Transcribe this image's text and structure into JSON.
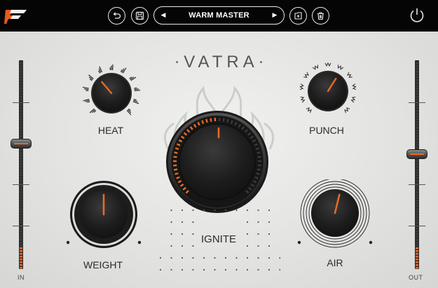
{
  "toolbar": {
    "preset_name": "WARM MASTER",
    "prev_arrow": "◀",
    "next_arrow": "▶",
    "undo_icon": "undo-icon",
    "save_icon": "save-icon",
    "new_preset_icon": "new-preset-icon",
    "delete_icon": "trash-icon",
    "power_icon": "power-icon",
    "logo_icon": "brand-logo"
  },
  "plugin": {
    "title": "VATRA"
  },
  "knobs": {
    "heat": {
      "label": "HEAT",
      "value": 0.35
    },
    "punch": {
      "label": "PUNCH",
      "value": 0.62
    },
    "ignite": {
      "label": "IGNITE",
      "value": 0.5
    },
    "weight": {
      "label": "WEIGHT",
      "value": 0.5
    },
    "air": {
      "label": "AIR",
      "value": 0.55
    }
  },
  "faders": {
    "input": {
      "label": "IN",
      "value": 0.6
    },
    "output": {
      "label": "OUT",
      "value": 0.55
    }
  },
  "colors": {
    "accent": "#e56b2a",
    "topbar": "#050505",
    "panel": "#e4e4e2",
    "knob": "#1c1c1c"
  }
}
